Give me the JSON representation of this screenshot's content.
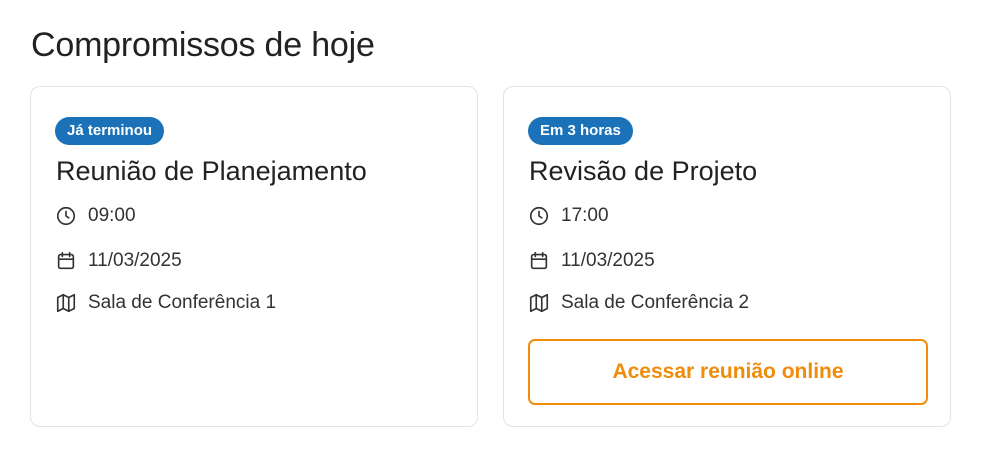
{
  "header": {
    "title": "Compromissos de hoje"
  },
  "colors": {
    "badge_bg": "#1b72b8",
    "accent_orange": "#ef8c0a",
    "card_border": "#e3e3e3",
    "text": "#222222"
  },
  "appointments": [
    {
      "badge": "Já terminou",
      "title": "Reunião de Planejamento",
      "time": "09:00",
      "date": "11/03/2025",
      "location": "Sala de Conferência 1",
      "time_icon": "clock-icon",
      "date_icon": "calendar-icon",
      "location_icon": "map-icon"
    },
    {
      "badge": "Em 3 horas",
      "title": "Revisão de Projeto",
      "time": "17:00",
      "date": "11/03/2025",
      "location": "Sala de Conferência 2",
      "time_icon": "clock-icon",
      "date_icon": "calendar-icon",
      "location_icon": "map-icon",
      "action_label": "Acessar reunião online"
    }
  ]
}
